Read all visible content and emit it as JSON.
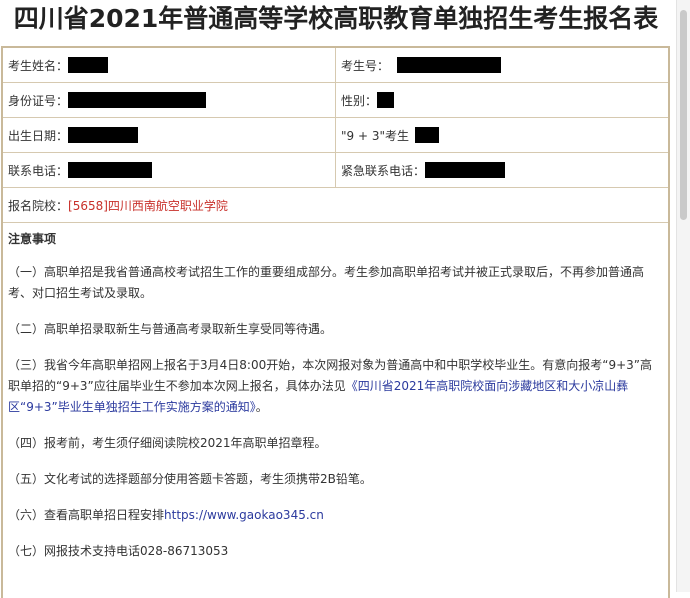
{
  "title": "四川省2021年普通高等学校高职教育单独招生考生报名表",
  "form": {
    "name_label": "考生姓名：",
    "exam_no_label": "考生号：",
    "id_label": "身份证号：",
    "gender_label": "性别：",
    "birth_label": "出生日期：",
    "nine_three_label": "\"9 + 3\"考生",
    "phone_label": "联系电话：",
    "emergency_label": "紧急联系电话：",
    "school_label": "报名院校：",
    "school_value": "[5658]四川西南航空职业学院"
  },
  "notes": {
    "heading": "注意事项",
    "item1": "（一）高职单招是我省普通高校考试招生工作的重要组成部分。考生参加高职单招考试并被正式录取后，不再参加普通高考、对口招生考试及录取。",
    "item2": "（二）高职单招录取新生与普通高考录取新生享受同等待遇。",
    "item3_pre": "（三）我省今年高职单招网上报名于3月4日8:00开始，本次网报对象为普通高中和中职学校毕业生。有意向报考“9+3”高职单招的“9+3”应往届毕业生不参加本次网上报名，具体办法见",
    "item3_link": "《四川省2021年高职院校面向涉藏地区和大小凉山彝区“9+3”毕业生单独招生工作实施方案的通知》",
    "item3_post": "。",
    "item4": "（四）报考前，考生须仔细阅读院校2021年高职单招章程。",
    "item5": "（五）文化考试的选择题部分使用答题卡答题，考生须携带2B铅笔。",
    "item6_pre": "（六）查看高职单招日程安排",
    "item6_link": "https://www.gaokao345.cn",
    "item7": "（七）网报技术支持电话028-86713053"
  },
  "colors": {
    "border": "#c9b99a",
    "school_red": "#c8302a",
    "link_blue": "#2b3a9e",
    "redaction": "#000000"
  }
}
